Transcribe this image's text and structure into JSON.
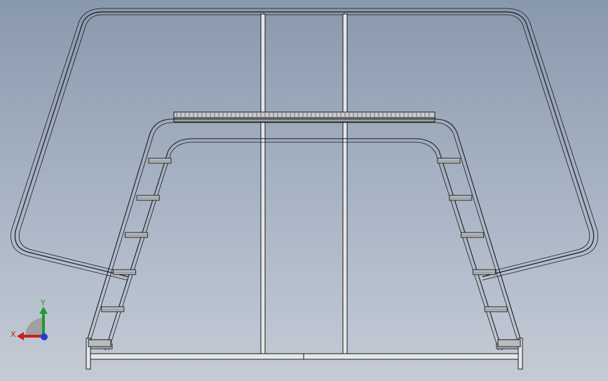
{
  "viewport": {
    "background_top": "#8999ad",
    "background_bottom": "#c4cbd6",
    "line_color": "#1a1a1a",
    "tube_fill": "#e9ecef",
    "tread_fill": "#b8bcc0"
  },
  "triad": {
    "x_label": "X",
    "y_label": "Y",
    "x_color": "#cc1f1f",
    "y_color": "#1f9b2a",
    "z_color": "#1f3fcc"
  },
  "model": {
    "left_ladder_steps": 6,
    "right_ladder_steps": 6
  }
}
